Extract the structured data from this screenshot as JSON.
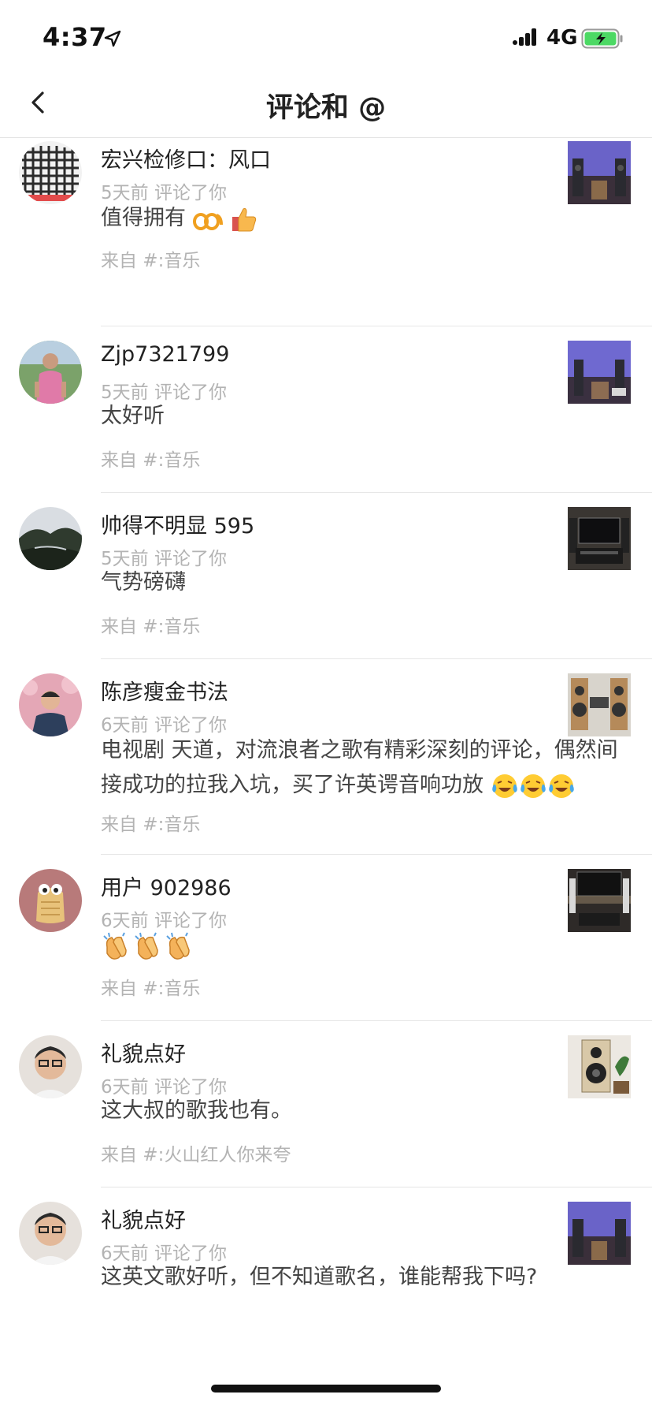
{
  "status_bar": {
    "time": "4:37",
    "network": "4G"
  },
  "nav": {
    "title": "评论和 @"
  },
  "comments": [
    {
      "name": "宏兴检修口：风口",
      "meta": "5天前 评论了你",
      "content": "值得拥有",
      "source": "来自 #:音乐",
      "emojis": [
        "ok-hand-icon",
        "thumbs-up-icon"
      ]
    },
    {
      "name": "Zjp7321799",
      "meta": "5天前 评论了你",
      "content": "太好听",
      "source": "来自 #:音乐",
      "emojis": []
    },
    {
      "name": "帅得不明显 595",
      "meta": "5天前 评论了你",
      "content": "气势磅礴",
      "source": "来自 #:音乐",
      "emojis": []
    },
    {
      "name": "陈彦瘦金书法",
      "meta": "6天前 评论了你",
      "content": "电视剧 天道，对流浪者之歌有精彩深刻的评论，偶然间接成功的拉我入坑，买了许英谔音响功放",
      "source": "来自 #:音乐",
      "emojis": [
        "laughing-tears-icon",
        "laughing-tears-icon",
        "laughing-tears-icon"
      ]
    },
    {
      "name": "用户 902986",
      "meta": "6天前 评论了你",
      "content": "",
      "source": "来自 #:音乐",
      "emojis": [
        "clapping-hands-icon",
        "clapping-hands-icon",
        "clapping-hands-icon"
      ]
    },
    {
      "name": "礼貌点好",
      "meta": "6天前 评论了你",
      "content": "这大叔的歌我也有。",
      "source": "来自 #:火山红人你来夸",
      "emojis": []
    },
    {
      "name": "礼貌点好",
      "meta": "6天前 评论了你",
      "content": "这英文歌好听，但不知道歌名，谁能帮我下吗?",
      "source": "",
      "emojis": []
    }
  ]
}
